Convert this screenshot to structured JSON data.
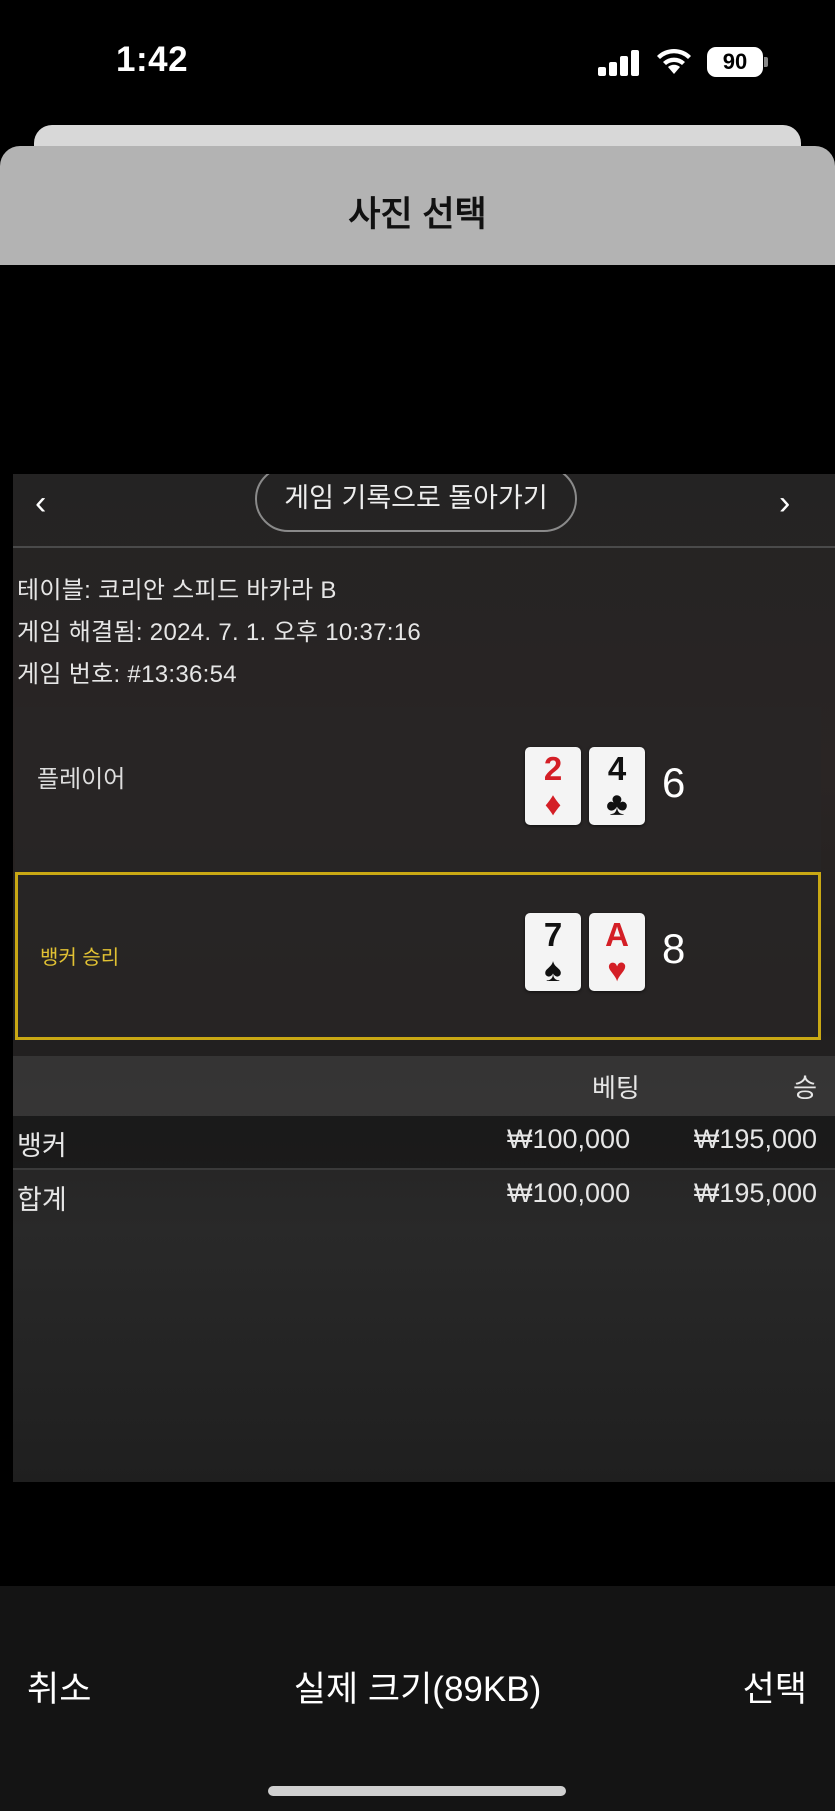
{
  "status_bar": {
    "time": "1:42",
    "battery": "90",
    "signal_bars": 4,
    "wifi": "wifi-icon"
  },
  "sheet": {
    "title": "사진 선택"
  },
  "screenshot": {
    "nav": {
      "prev": "‹",
      "back_label": "게임 기록으로 돌아가기",
      "next": "›"
    },
    "info": {
      "table": "테이블: 코리안 스피드 바카라 B",
      "resolved": "게임 해결됨: 2024. 7. 1. 오후 10:37:16",
      "game_number": "게임 번호: #13:36:54"
    },
    "player": {
      "label": "플레이어",
      "cards": [
        {
          "rank": "2",
          "suit": "♦"
        },
        {
          "rank": "4",
          "suit": "♣"
        }
      ],
      "score": "6"
    },
    "banker": {
      "label": "뱅커 승리",
      "cards": [
        {
          "rank": "7",
          "suit": "♠"
        },
        {
          "rank": "A",
          "suit": "♥"
        }
      ],
      "score": "8"
    },
    "bets_table": {
      "headers": {
        "bet": "베팅",
        "win": "승"
      },
      "rows": [
        {
          "name": "뱅커",
          "bet": "₩100,000",
          "win": "₩195,000"
        },
        {
          "name": "합계",
          "bet": "₩100,000",
          "win": "₩195,000"
        }
      ]
    },
    "colors": {
      "winner_border": "#c9a814",
      "red_suit": "#d41f26"
    }
  },
  "toolbar": {
    "cancel": "취소",
    "size": "실제 크기(89KB)",
    "select": "선택"
  }
}
